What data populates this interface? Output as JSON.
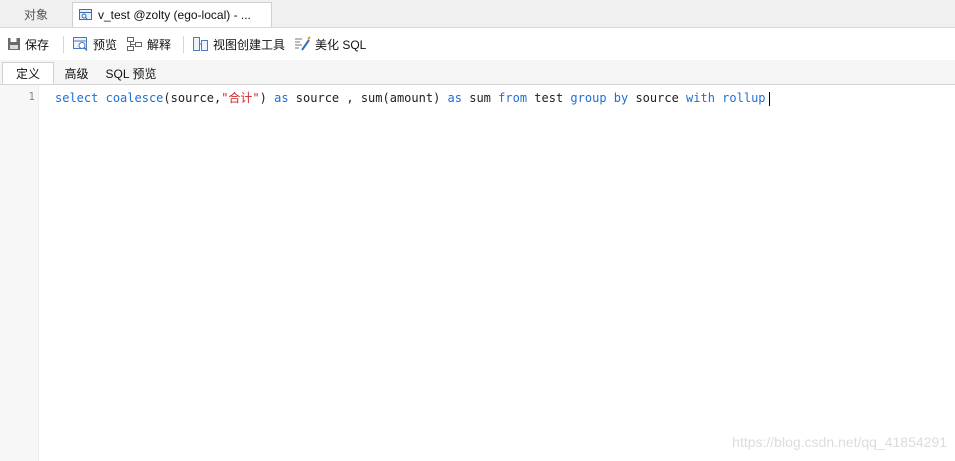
{
  "doc_tabs": {
    "objects_label": "对象",
    "active_label": "v_test @zolty (ego-local) - ..."
  },
  "toolbar": {
    "save_label": "保存",
    "preview_label": "预览",
    "explain_label": "解释",
    "view_builder_label": "视图创建工具",
    "beautify_label": "美化 SQL"
  },
  "sub_tabs": {
    "definition": "定义",
    "advanced": "高级",
    "sql_preview": "SQL 预览"
  },
  "editor": {
    "line_number": "1",
    "tokens": {
      "t1": "select",
      "t2": "coalesce",
      "t3": "(source,",
      "t4": "\"合计\"",
      "t5": ")",
      "t6": "as",
      "t7": "source , sum(amount)",
      "t8": "as",
      "t9": "sum",
      "t10": "from",
      "t11": "test",
      "t12": "group by",
      "t13": "source",
      "t14": "with rollup"
    }
  },
  "watermark": "https://blog.csdn.net/qq_41854291",
  "colors": {
    "keyword": "#1f6fd1",
    "string": "#d02828"
  }
}
